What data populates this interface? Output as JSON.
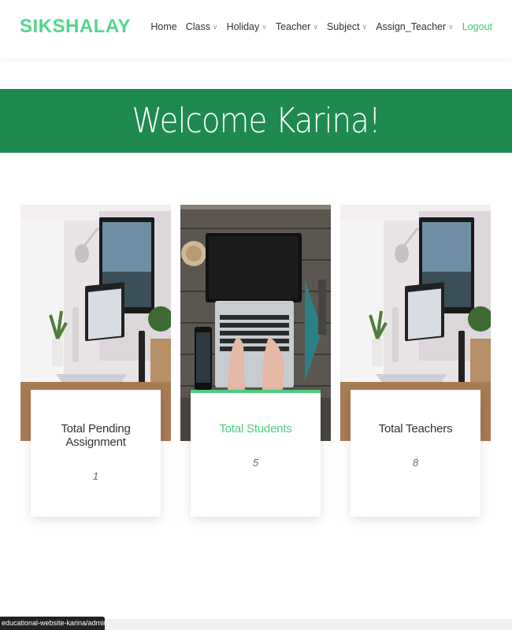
{
  "brand": "SIKSHALAY",
  "nav": [
    {
      "label": "Home",
      "dropdown": false
    },
    {
      "label": "Class",
      "dropdown": true
    },
    {
      "label": "Holiday",
      "dropdown": true
    },
    {
      "label": "Teacher",
      "dropdown": true
    },
    {
      "label": "Subject",
      "dropdown": true
    },
    {
      "label": "Assign_Teacher",
      "dropdown": true
    },
    {
      "label": "Logout",
      "dropdown": false
    }
  ],
  "welcome": "Welcome Karina!",
  "cards": [
    {
      "title": "Total Pending Assignment",
      "value": "1"
    },
    {
      "title": "Total Students",
      "value": "5"
    },
    {
      "title": "Total Teachers",
      "value": "8"
    }
  ],
  "status_url": "educational-website-karina/admin/view_student.php",
  "colors": {
    "brand": "#52d68a",
    "banner": "#1e8a50",
    "accent": "#4cce7d"
  }
}
